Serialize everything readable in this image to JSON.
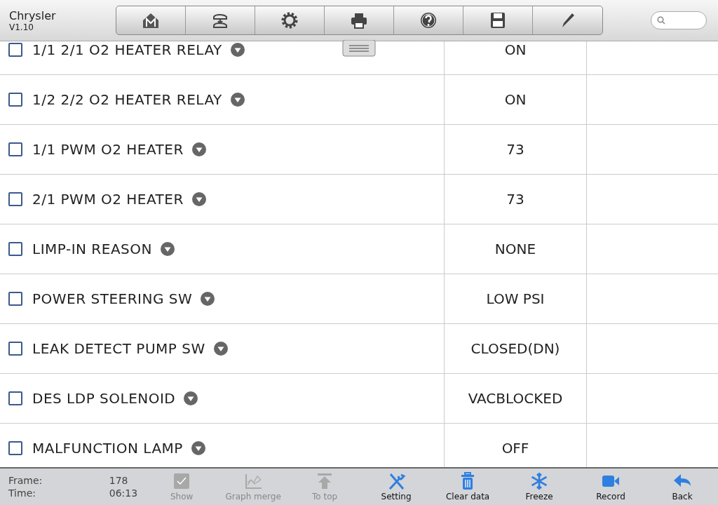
{
  "header": {
    "title": "Chrysler",
    "version": "V1.10"
  },
  "toolbar": [
    {
      "kind": "home"
    },
    {
      "kind": "vehicle"
    },
    {
      "kind": "settings"
    },
    {
      "kind": "print"
    },
    {
      "kind": "help"
    },
    {
      "kind": "save"
    },
    {
      "kind": "edit"
    }
  ],
  "rows": [
    {
      "name": "1/1 2/1 O2 HEATER RELAY",
      "checked": false,
      "value": "ON"
    },
    {
      "name": "1/2 2/2 O2 HEATER RELAY",
      "checked": false,
      "value": "ON"
    },
    {
      "name": "1/1 PWM O2 HEATER",
      "checked": false,
      "value": "73"
    },
    {
      "name": "2/1 PWM O2 HEATER",
      "checked": false,
      "value": "73"
    },
    {
      "name": "LIMP-IN REASON",
      "checked": false,
      "value": "NONE"
    },
    {
      "name": "POWER STEERING SW",
      "checked": false,
      "value": "LOW PSI"
    },
    {
      "name": "LEAK DETECT PUMP SW",
      "checked": false,
      "value": "CLOSED(DN)"
    },
    {
      "name": "DES LDP SOLENOID",
      "checked": false,
      "value": "VACBLOCKED"
    },
    {
      "name": "MALFUNCTION LAMP",
      "checked": false,
      "value": "OFF"
    }
  ],
  "status": {
    "frame_label": "Frame:",
    "frame": "178",
    "time_label": "Time:",
    "time": "06:13"
  },
  "actions": [
    {
      "kind": "show",
      "label": "Show",
      "disabled": true
    },
    {
      "kind": "graph",
      "label": "Graph merge",
      "disabled": true
    },
    {
      "kind": "top",
      "label": "To top",
      "disabled": true
    },
    {
      "kind": "setting",
      "label": "Setting",
      "disabled": false
    },
    {
      "kind": "clear",
      "label": "Clear data",
      "disabled": false
    },
    {
      "kind": "freeze",
      "label": "Freeze",
      "disabled": false
    },
    {
      "kind": "record",
      "label": "Record",
      "disabled": false
    },
    {
      "kind": "back",
      "label": "Back",
      "disabled": false
    }
  ]
}
